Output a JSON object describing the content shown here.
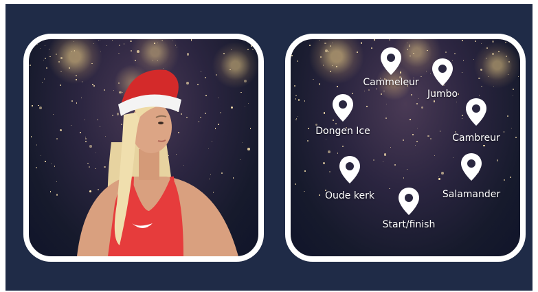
{
  "locations": [
    {
      "id": "cammeleur",
      "label": "Cammeleur"
    },
    {
      "id": "jumbo",
      "label": "Jumbo"
    },
    {
      "id": "dongen-ice",
      "label": "Dongen Ice"
    },
    {
      "id": "cambreur",
      "label": "Cambreur"
    },
    {
      "id": "oude-kerk",
      "label": "Oude kerk"
    },
    {
      "id": "salamander",
      "label": "Salamander"
    },
    {
      "id": "start-finish",
      "label": "Start/finish"
    }
  ],
  "colors": {
    "background": "#1f2b47",
    "card_border": "#ffffff",
    "pin_fill": "#ffffff",
    "top_red": "#e63c3c",
    "hat_red": "#d42a2a"
  },
  "icons": {
    "pin": "map-pin-icon",
    "swoosh": "swoosh-logo-icon"
  }
}
